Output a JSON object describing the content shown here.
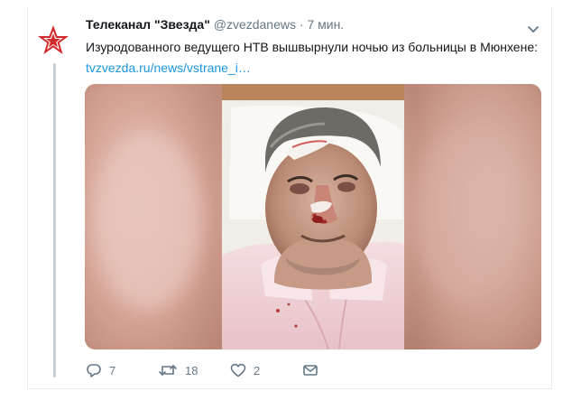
{
  "tweet": {
    "author_name": "Телеканал \"Звезда\"",
    "handle": "@zvezdanews",
    "separator": "·",
    "time": "7 мин.",
    "text": "Изуродованного ведущего НТВ вышвырнули ночью из больницы в Мюнхене:",
    "link": "tvzvezda.ru/news/vstrane_i…"
  },
  "actions": {
    "replies": "7",
    "retweets": "18",
    "likes": "2"
  },
  "icons": {
    "avatar": "red-star-logo",
    "menu": "chevron-down-icon",
    "reply": "reply-icon",
    "retweet": "retweet-icon",
    "like": "heart-icon",
    "dm": "envelope-icon"
  },
  "colors": {
    "link": "#1b95e0",
    "text": "#14171a",
    "muted": "#657786",
    "logo_red": "#d22a2a"
  }
}
